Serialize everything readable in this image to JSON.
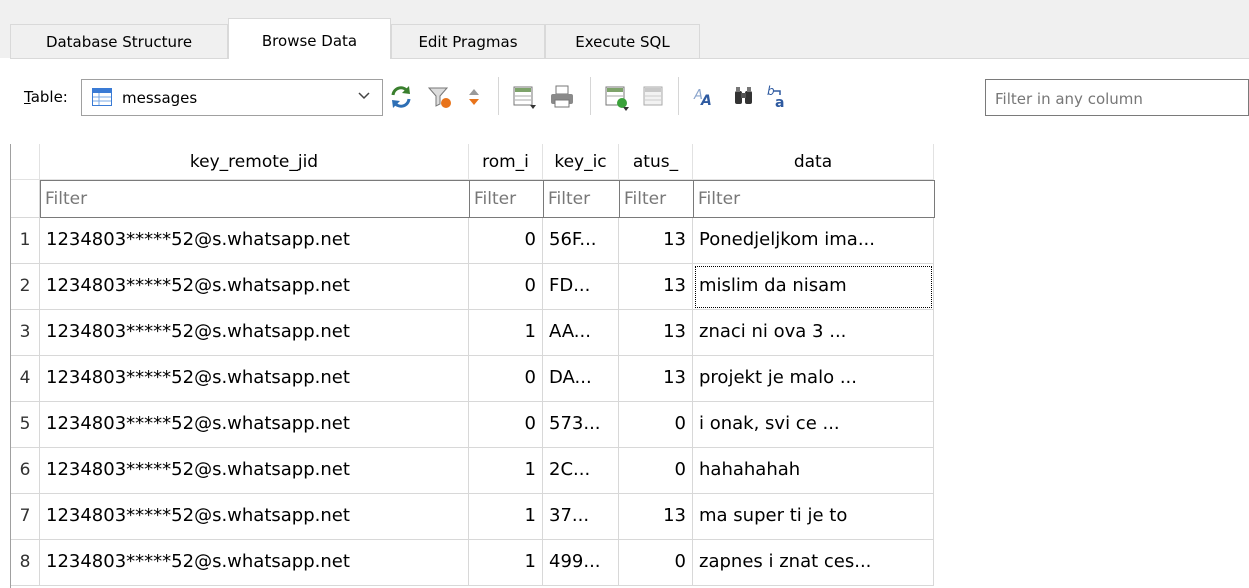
{
  "tabs": [
    {
      "label": "Database Structure",
      "active": false
    },
    {
      "label": "Browse Data",
      "active": true
    },
    {
      "label": "Edit Pragmas",
      "active": false
    },
    {
      "label": "Execute SQL",
      "active": false
    }
  ],
  "toolbar": {
    "table_label_prefix": "T",
    "table_label_rest": "able:",
    "table_value": "messages",
    "filter_placeholder": "Filter in any column"
  },
  "grid": {
    "columns": [
      "key_remote_jid",
      "rom_i",
      "key_ic",
      "atus_",
      "data"
    ],
    "filter_placeholder": "Filter",
    "rows": [
      {
        "n": "1",
        "jid": "1234803*****52@s.whatsapp.net",
        "from": "0",
        "key": "56F...",
        "status": "13",
        "data": "Ponedjeljkom ima..."
      },
      {
        "n": "2",
        "jid": "1234803*****52@s.whatsapp.net",
        "from": "0",
        "key": "FD...",
        "status": "13",
        "data": "mislim da nisam"
      },
      {
        "n": "3",
        "jid": "1234803*****52@s.whatsapp.net",
        "from": "1",
        "key": "AA...",
        "status": "13",
        "data": "znaci ni ova 3 ..."
      },
      {
        "n": "4",
        "jid": "1234803*****52@s.whatsapp.net",
        "from": "0",
        "key": "DA...",
        "status": "13",
        "data": "projekt je malo ..."
      },
      {
        "n": "5",
        "jid": "1234803*****52@s.whatsapp.net",
        "from": "0",
        "key": "573...",
        "status": "0",
        "data": "i onak, svi ce ..."
      },
      {
        "n": "6",
        "jid": "1234803*****52@s.whatsapp.net",
        "from": "1",
        "key": "2C...",
        "status": "0",
        "data": "hahahahah"
      },
      {
        "n": "7",
        "jid": "1234803*****52@s.whatsapp.net",
        "from": "1",
        "key": "37...",
        "status": "13",
        "data": "ma super ti je to"
      },
      {
        "n": "8",
        "jid": "1234803*****52@s.whatsapp.net",
        "from": "1",
        "key": "499...",
        "status": "0",
        "data": "zapnes i znat ces..."
      }
    ]
  },
  "icons": [
    "table-icon",
    "refresh-icon",
    "clear-filters-icon",
    "sort-icon",
    "new-record-icon",
    "print-icon",
    "insert-record-icon",
    "delete-record-icon",
    "find-icon",
    "find-replace-icon",
    "replace-icon"
  ]
}
